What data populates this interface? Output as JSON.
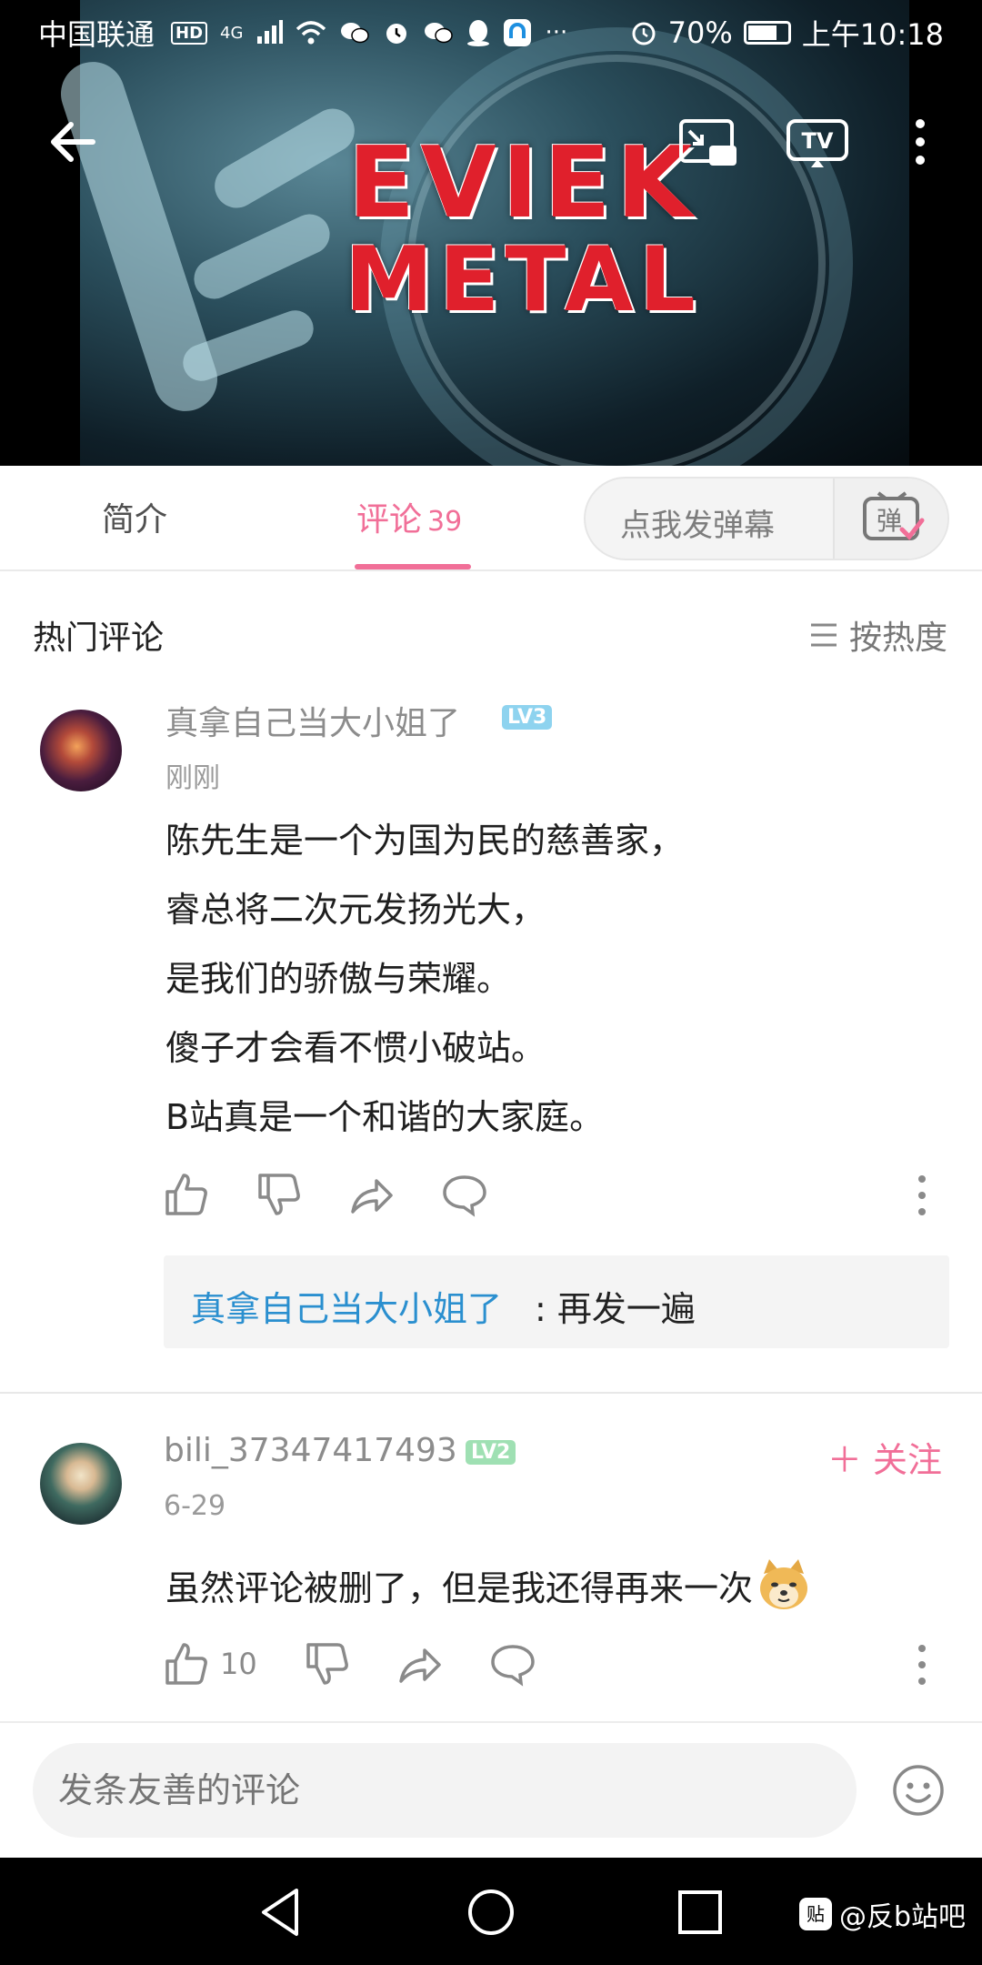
{
  "status_bar": {
    "carrier": "中国联通",
    "hd_badge": "HD",
    "network": "4G",
    "battery": "70%",
    "time": "上午10:18"
  },
  "video": {
    "title_line1": "EVIEK",
    "title_line2": "METAL"
  },
  "tabs": {
    "intro": "简介",
    "comments": "评论",
    "comments_count": "39"
  },
  "danmaku": {
    "placeholder": "点我发弹幕",
    "icon_label": "弹"
  },
  "section": {
    "title": "热门评论",
    "sort_label": "按热度"
  },
  "comments": [
    {
      "username": "真拿自己当大小姐了",
      "level": "LV3",
      "time": "刚刚",
      "lines": [
        "陈先生是一个为国为民的慈善家，",
        "睿总将二次元发扬光大，",
        "是我们的骄傲与荣耀。",
        "傻子才会看不惯小破站。",
        "B站真是一个和谐的大家庭。"
      ],
      "reply": {
        "name": "真拿自己当大小姐了",
        "text": ": 再发一遍"
      }
    },
    {
      "username": "bili_37347417493",
      "level": "LV2",
      "time": "6-29",
      "follow": "＋ 关注",
      "text": "虽然评论被删了，但是我还得再来一次",
      "likes": "10"
    }
  ],
  "input": {
    "placeholder": "发条友善的评论"
  },
  "watermark": {
    "badge": "贴",
    "text": "@反b站吧"
  }
}
